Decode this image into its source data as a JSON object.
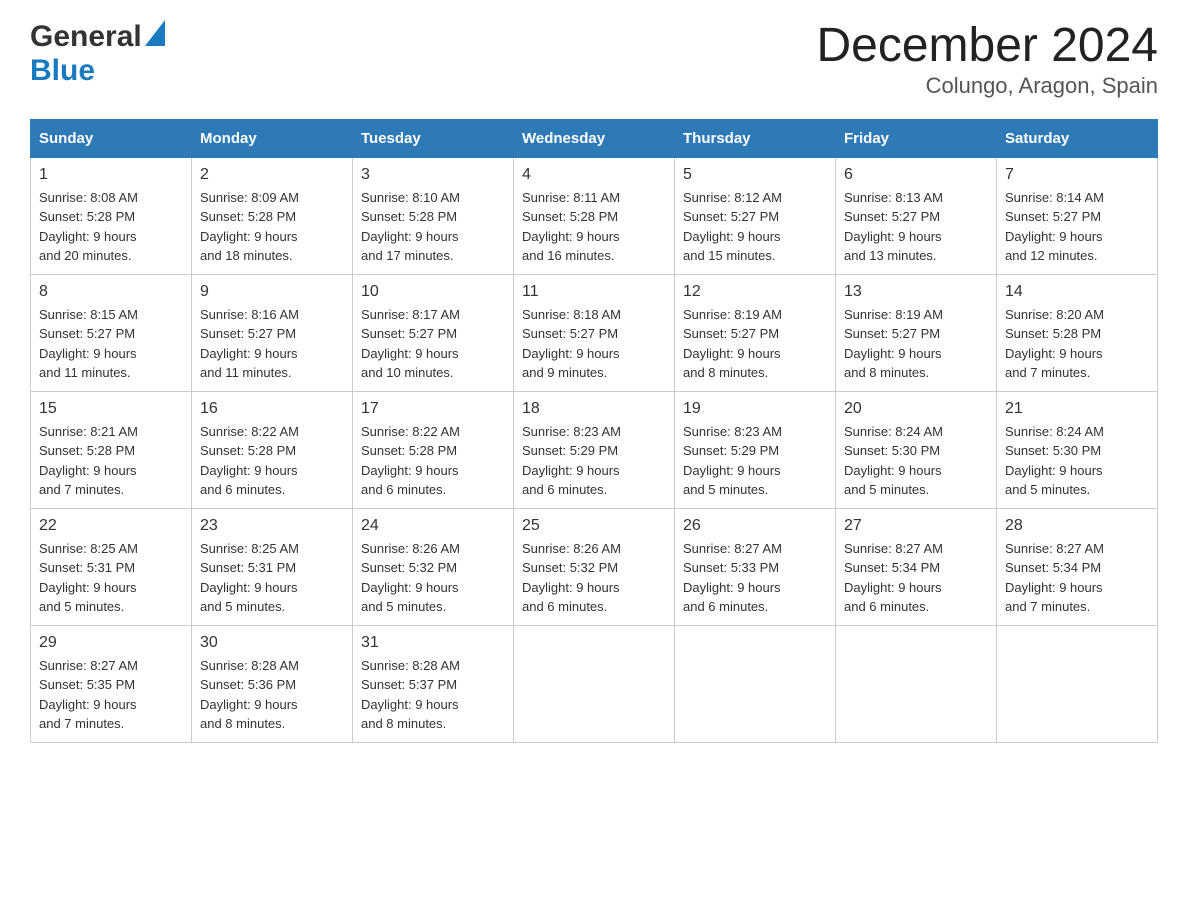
{
  "logo": {
    "general": "General",
    "blue": "Blue"
  },
  "title": "December 2024",
  "subtitle": "Colungo, Aragon, Spain",
  "headers": [
    "Sunday",
    "Monday",
    "Tuesday",
    "Wednesday",
    "Thursday",
    "Friday",
    "Saturday"
  ],
  "weeks": [
    [
      {
        "day": "1",
        "sunrise": "8:08 AM",
        "sunset": "5:28 PM",
        "daylight": "9 hours and 20 minutes."
      },
      {
        "day": "2",
        "sunrise": "8:09 AM",
        "sunset": "5:28 PM",
        "daylight": "9 hours and 18 minutes."
      },
      {
        "day": "3",
        "sunrise": "8:10 AM",
        "sunset": "5:28 PM",
        "daylight": "9 hours and 17 minutes."
      },
      {
        "day": "4",
        "sunrise": "8:11 AM",
        "sunset": "5:28 PM",
        "daylight": "9 hours and 16 minutes."
      },
      {
        "day": "5",
        "sunrise": "8:12 AM",
        "sunset": "5:27 PM",
        "daylight": "9 hours and 15 minutes."
      },
      {
        "day": "6",
        "sunrise": "8:13 AM",
        "sunset": "5:27 PM",
        "daylight": "9 hours and 13 minutes."
      },
      {
        "day": "7",
        "sunrise": "8:14 AM",
        "sunset": "5:27 PM",
        "daylight": "9 hours and 12 minutes."
      }
    ],
    [
      {
        "day": "8",
        "sunrise": "8:15 AM",
        "sunset": "5:27 PM",
        "daylight": "9 hours and 11 minutes."
      },
      {
        "day": "9",
        "sunrise": "8:16 AM",
        "sunset": "5:27 PM",
        "daylight": "9 hours and 11 minutes."
      },
      {
        "day": "10",
        "sunrise": "8:17 AM",
        "sunset": "5:27 PM",
        "daylight": "9 hours and 10 minutes."
      },
      {
        "day": "11",
        "sunrise": "8:18 AM",
        "sunset": "5:27 PM",
        "daylight": "9 hours and 9 minutes."
      },
      {
        "day": "12",
        "sunrise": "8:19 AM",
        "sunset": "5:27 PM",
        "daylight": "9 hours and 8 minutes."
      },
      {
        "day": "13",
        "sunrise": "8:19 AM",
        "sunset": "5:27 PM",
        "daylight": "9 hours and 8 minutes."
      },
      {
        "day": "14",
        "sunrise": "8:20 AM",
        "sunset": "5:28 PM",
        "daylight": "9 hours and 7 minutes."
      }
    ],
    [
      {
        "day": "15",
        "sunrise": "8:21 AM",
        "sunset": "5:28 PM",
        "daylight": "9 hours and 7 minutes."
      },
      {
        "day": "16",
        "sunrise": "8:22 AM",
        "sunset": "5:28 PM",
        "daylight": "9 hours and 6 minutes."
      },
      {
        "day": "17",
        "sunrise": "8:22 AM",
        "sunset": "5:28 PM",
        "daylight": "9 hours and 6 minutes."
      },
      {
        "day": "18",
        "sunrise": "8:23 AM",
        "sunset": "5:29 PM",
        "daylight": "9 hours and 6 minutes."
      },
      {
        "day": "19",
        "sunrise": "8:23 AM",
        "sunset": "5:29 PM",
        "daylight": "9 hours and 5 minutes."
      },
      {
        "day": "20",
        "sunrise": "8:24 AM",
        "sunset": "5:30 PM",
        "daylight": "9 hours and 5 minutes."
      },
      {
        "day": "21",
        "sunrise": "8:24 AM",
        "sunset": "5:30 PM",
        "daylight": "9 hours and 5 minutes."
      }
    ],
    [
      {
        "day": "22",
        "sunrise": "8:25 AM",
        "sunset": "5:31 PM",
        "daylight": "9 hours and 5 minutes."
      },
      {
        "day": "23",
        "sunrise": "8:25 AM",
        "sunset": "5:31 PM",
        "daylight": "9 hours and 5 minutes."
      },
      {
        "day": "24",
        "sunrise": "8:26 AM",
        "sunset": "5:32 PM",
        "daylight": "9 hours and 5 minutes."
      },
      {
        "day": "25",
        "sunrise": "8:26 AM",
        "sunset": "5:32 PM",
        "daylight": "9 hours and 6 minutes."
      },
      {
        "day": "26",
        "sunrise": "8:27 AM",
        "sunset": "5:33 PM",
        "daylight": "9 hours and 6 minutes."
      },
      {
        "day": "27",
        "sunrise": "8:27 AM",
        "sunset": "5:34 PM",
        "daylight": "9 hours and 6 minutes."
      },
      {
        "day": "28",
        "sunrise": "8:27 AM",
        "sunset": "5:34 PM",
        "daylight": "9 hours and 7 minutes."
      }
    ],
    [
      {
        "day": "29",
        "sunrise": "8:27 AM",
        "sunset": "5:35 PM",
        "daylight": "9 hours and 7 minutes."
      },
      {
        "day": "30",
        "sunrise": "8:28 AM",
        "sunset": "5:36 PM",
        "daylight": "9 hours and 8 minutes."
      },
      {
        "day": "31",
        "sunrise": "8:28 AM",
        "sunset": "5:37 PM",
        "daylight": "9 hours and 8 minutes."
      },
      null,
      null,
      null,
      null
    ]
  ],
  "labels": {
    "sunrise": "Sunrise:",
    "sunset": "Sunset:",
    "daylight": "Daylight:"
  }
}
